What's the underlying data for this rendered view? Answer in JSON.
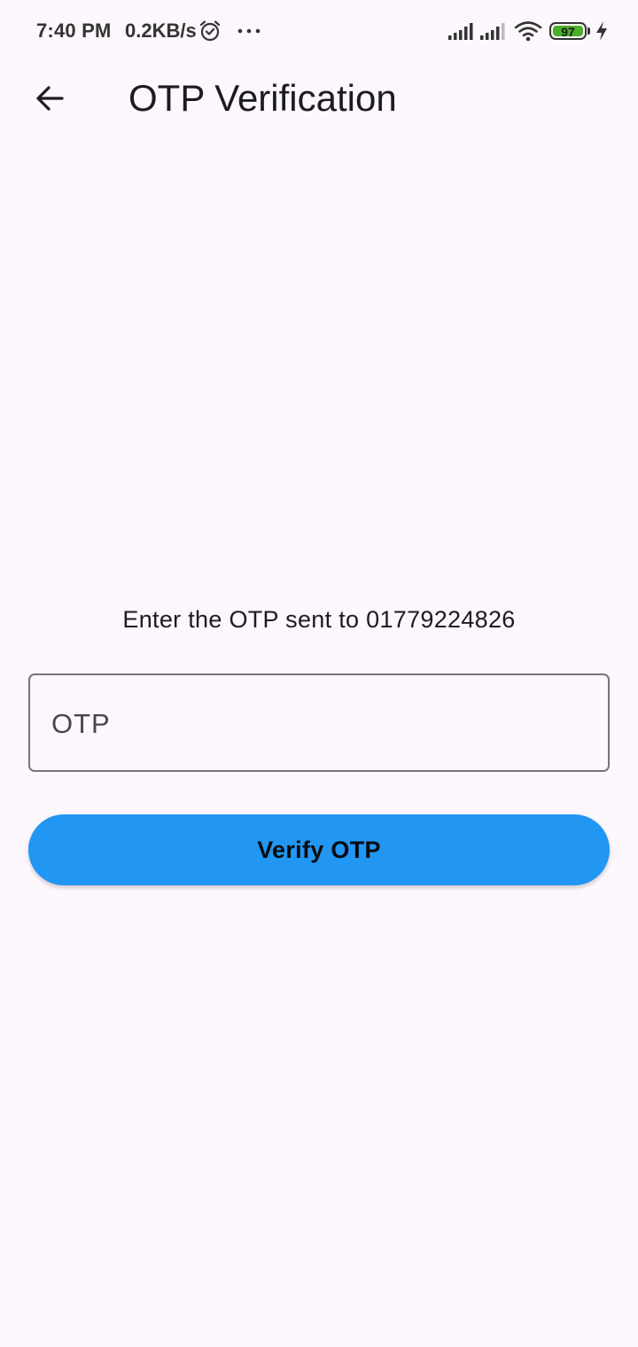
{
  "status_bar": {
    "time": "7:40 PM",
    "network_speed": "0.2KB/s",
    "battery_level": "97",
    "icons": [
      "alarm-icon",
      "more-dots-icon",
      "cell-signal-icon",
      "cell-signal-icon",
      "wifi-icon",
      "battery-icon",
      "charging-icon"
    ],
    "battery_color": "#4caf28"
  },
  "app_bar": {
    "back_icon": "arrow-back-icon",
    "title": "OTP Verification"
  },
  "main": {
    "instruction": "Enter the OTP sent to 01779224826",
    "otp_input": {
      "placeholder": "OTP",
      "value": ""
    },
    "verify_button": {
      "label": "Verify OTP",
      "color": "#2196f3"
    }
  },
  "theme": {
    "background": "#fdf7fe",
    "text": "#1c1b1f",
    "outline": "#79747e"
  }
}
